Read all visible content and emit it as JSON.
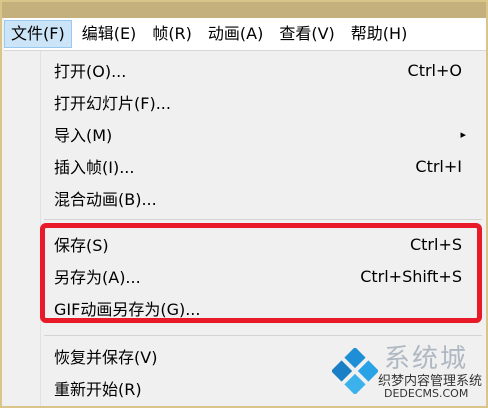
{
  "menubar": {
    "items": [
      {
        "label": "文件(F)",
        "active": true
      },
      {
        "label": "编辑(E)"
      },
      {
        "label": "帧(R)"
      },
      {
        "label": "动画(A)"
      },
      {
        "label": "查看(V)"
      },
      {
        "label": "帮助(H)"
      }
    ]
  },
  "file_menu": {
    "items": [
      {
        "label": "打开(O)...",
        "shortcut": "Ctrl+O"
      },
      {
        "label": "打开幻灯片(F)...",
        "shortcut": ""
      },
      {
        "label": "导入(M)",
        "submenu_arrow": "▸"
      },
      {
        "label": "插入帧(I)...",
        "shortcut": "Ctrl+I"
      },
      {
        "label": "混合动画(B)...",
        "shortcut": ""
      },
      {
        "label": "保存(S)",
        "shortcut": "Ctrl+S"
      },
      {
        "label": "另存为(A)...",
        "shortcut": "Ctrl+Shift+S"
      },
      {
        "label": "GIF动画另存为(G)...",
        "shortcut": ""
      },
      {
        "label": "恢复并保存(V)",
        "shortcut": ""
      },
      {
        "label": "重新开始(R)",
        "shortcut": ""
      }
    ]
  },
  "watermark": {
    "brand": "系统城",
    "tagline": "织梦内容管理系统",
    "url": "DEDECMS.COM",
    "domain": "xitongcheng.com"
  },
  "colors": {
    "highlight_border": "#e81a2a",
    "menu_active_bg": "#cce4f7"
  }
}
